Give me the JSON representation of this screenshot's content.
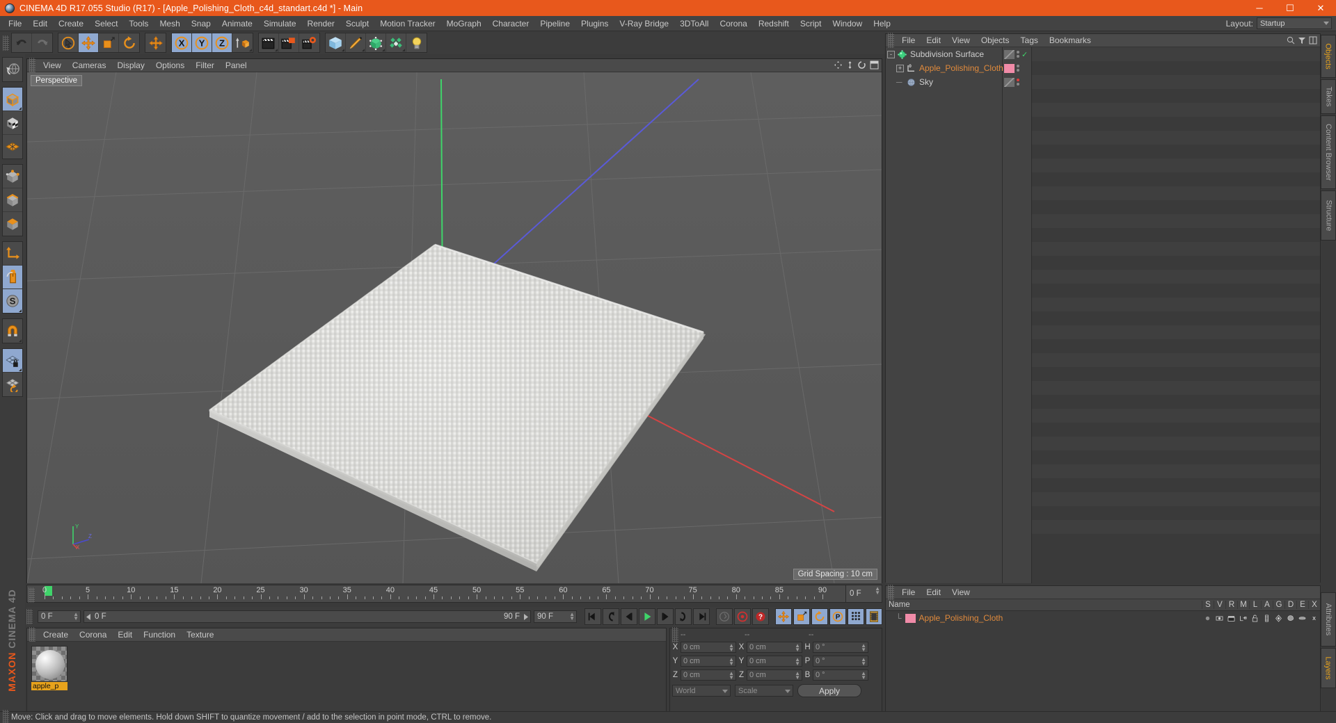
{
  "titlebar": {
    "title": "CINEMA 4D R17.055 Studio (R17) - [Apple_Polishing_Cloth_c4d_standart.c4d *] - Main",
    "minimize": "─",
    "maximize": "☐",
    "close": "✕"
  },
  "menubar": {
    "items": [
      "File",
      "Edit",
      "Create",
      "Select",
      "Tools",
      "Mesh",
      "Snap",
      "Animate",
      "Simulate",
      "Render",
      "Sculpt",
      "Motion Tracker",
      "MoGraph",
      "Character",
      "Pipeline",
      "Plugins",
      "V-Ray Bridge",
      "3DToAll",
      "Corona",
      "Redshift",
      "Script",
      "Window",
      "Help"
    ],
    "layout_label": "Layout:",
    "layout_value": "Startup"
  },
  "toolbar": {
    "groups": [
      {
        "buttons": [
          {
            "name": "undo-button",
            "icon": "undo",
            "active": false
          },
          {
            "name": "redo-button",
            "icon": "redo",
            "active": false
          }
        ]
      },
      {
        "buttons": [
          {
            "name": "live-selection-tool",
            "icon": "cursor-circle",
            "active": false
          },
          {
            "name": "move-tool",
            "icon": "move-arrows",
            "active": true
          },
          {
            "name": "scale-tool",
            "icon": "scale-box",
            "active": false
          },
          {
            "name": "rotate-tool",
            "icon": "rotate-arc",
            "active": false
          }
        ]
      },
      {
        "buttons": [
          {
            "name": "world-axis-tool",
            "icon": "move-arrows",
            "active": false
          }
        ]
      },
      {
        "buttons": [
          {
            "name": "lock-x-axis",
            "icon": "axis-x",
            "active": true
          },
          {
            "name": "lock-y-axis",
            "icon": "axis-y",
            "active": true
          },
          {
            "name": "lock-z-axis",
            "icon": "axis-z",
            "active": true
          },
          {
            "name": "world-object-coordinates",
            "icon": "world-cube",
            "active": false
          }
        ]
      },
      {
        "buttons": [
          {
            "name": "render-view-button",
            "icon": "clapper",
            "active": false
          },
          {
            "name": "render-to-picture-viewer",
            "icon": "clapper-region",
            "active": false
          },
          {
            "name": "render-settings-button",
            "icon": "clapper-gear",
            "active": false
          }
        ]
      },
      {
        "buttons": [
          {
            "name": "add-cube-primitive",
            "icon": "cube-blue",
            "active": false
          },
          {
            "name": "add-spline-pen",
            "icon": "pen",
            "active": false
          },
          {
            "name": "add-generator",
            "icon": "green-cube-nurbs",
            "active": false
          },
          {
            "name": "add-deformer",
            "icon": "green-scatter",
            "active": false
          },
          {
            "name": "add-scene-object",
            "icon": "light-bulb",
            "active": false
          }
        ]
      }
    ]
  },
  "left_toolbar": {
    "groups": [
      {
        "buttons": [
          {
            "name": "undo-view-button",
            "icon": "globe-undo",
            "active": false
          }
        ]
      },
      {
        "buttons": [
          {
            "name": "model-mode",
            "icon": "cube-orange-outline",
            "active": true
          },
          {
            "name": "texture-mode",
            "icon": "cube-checker",
            "active": false
          },
          {
            "name": "points-mode-grid",
            "icon": "orange-grid",
            "active": false
          }
        ]
      },
      {
        "buttons": [
          {
            "name": "points-mode",
            "icon": "cube-points",
            "active": false
          },
          {
            "name": "edges-mode",
            "icon": "cube-edges",
            "active": false
          },
          {
            "name": "polygons-mode",
            "icon": "cube-polygons",
            "active": false
          }
        ]
      },
      {
        "buttons": [
          {
            "name": "axis-mode",
            "icon": "axis-L",
            "active": false
          },
          {
            "name": "viewport-solo-mouse",
            "icon": "mouse",
            "active": true
          },
          {
            "name": "enable-snap",
            "icon": "snap-s",
            "active": true
          }
        ]
      },
      {
        "buttons": [
          {
            "name": "magnet-tool",
            "icon": "magnet",
            "active": false
          }
        ]
      },
      {
        "buttons": [
          {
            "name": "workplane-lock",
            "icon": "grid-lock",
            "active": true
          },
          {
            "name": "workplane-reset",
            "icon": "grid-reset",
            "active": false
          }
        ]
      }
    ]
  },
  "viewport": {
    "menu": [
      "View",
      "Cameras",
      "Display",
      "Options",
      "Filter",
      "Panel"
    ],
    "label": "Perspective",
    "grid_spacing": "Grid Spacing : 10 cm",
    "icons": [
      "move-view-icon",
      "zoom-view-icon",
      "rotate-view-icon",
      "maximize-view-icon"
    ],
    "axis_gizmo": {
      "y": "Y",
      "x": "X",
      "z": "Z"
    }
  },
  "object_manager": {
    "menu": [
      "File",
      "Edit",
      "View",
      "Objects",
      "Tags",
      "Bookmarks"
    ],
    "search_icons": [
      "search-icon",
      "filter-icon",
      "layout-icon"
    ],
    "nodes": [
      {
        "name": "Subdivision Surface",
        "icon": "subdivision-surface-icon",
        "indent": 0,
        "expander": "-",
        "selected": false,
        "swatch": "none",
        "check": "✓",
        "dot": "gray"
      },
      {
        "name": "Apple_Polishing_Cloth",
        "icon": "null-object-icon",
        "indent": 1,
        "expander": "+",
        "selected": true,
        "swatch": "#f08ba8",
        "check": "",
        "dot": "gray"
      },
      {
        "name": "Sky",
        "icon": "sky-icon",
        "indent": 1,
        "expander": "",
        "selected": false,
        "swatch": "none",
        "check": "",
        "dot": "red"
      }
    ]
  },
  "timeline": {
    "ticks": [
      0,
      5,
      10,
      15,
      20,
      25,
      30,
      35,
      40,
      45,
      50,
      55,
      60,
      65,
      70,
      75,
      80,
      85,
      90
    ],
    "start_frame": "0 F",
    "end_frame": "90 F",
    "current_frame": "0 F",
    "range_start": "0 F",
    "range_end": "90 F"
  },
  "transport": {
    "buttons": [
      {
        "name": "go-to-start-button",
        "icon": "skip-back"
      },
      {
        "name": "go-to-previous-key-button",
        "icon": "prev-key"
      },
      {
        "name": "go-to-previous-frame-button",
        "icon": "step-back"
      },
      {
        "name": "play-button",
        "icon": "play"
      },
      {
        "name": "go-to-next-frame-button",
        "icon": "step-fwd"
      },
      {
        "name": "go-to-next-key-button",
        "icon": "next-key"
      },
      {
        "name": "go-to-end-button",
        "icon": "skip-fwd"
      },
      {
        "name": "record-active-objects-button",
        "icon": "key-gray"
      },
      {
        "name": "autokeying-button",
        "icon": "record-red"
      },
      {
        "name": "keyframe-selection-button",
        "icon": "question-red"
      },
      {
        "name": "record-position-button",
        "icon": "move-arrows",
        "active": true
      },
      {
        "name": "record-scale-button",
        "icon": "scale-box",
        "active": true
      },
      {
        "name": "record-rotation-button",
        "icon": "rotate-arc",
        "active": true
      },
      {
        "name": "record-parameter-button",
        "icon": "param-p",
        "active": true
      },
      {
        "name": "record-pla-button",
        "icon": "dots-grid",
        "active": true
      },
      {
        "name": "timeline-button",
        "icon": "film-strip",
        "active": true
      }
    ]
  },
  "material_manager": {
    "menu": [
      "Create",
      "Corona",
      "Edit",
      "Function",
      "Texture"
    ],
    "materials": [
      {
        "name": "apple_p",
        "preview": "sphere-preview"
      }
    ]
  },
  "coordinates": {
    "headers": [
      "--",
      "--",
      "--"
    ],
    "rows": [
      {
        "label1": "X",
        "value1": "0 cm",
        "label2": "X",
        "value2": "0 cm",
        "label3": "H",
        "value3": "0 °"
      },
      {
        "label1": "Y",
        "value1": "0 cm",
        "label2": "Y",
        "value2": "0 cm",
        "label3": "P",
        "value3": "0 °"
      },
      {
        "label1": "Z",
        "value1": "0 cm",
        "label2": "Z",
        "value2": "0 cm",
        "label3": "B",
        "value3": "0 °"
      }
    ],
    "system": "World",
    "mode": "Scale",
    "apply": "Apply"
  },
  "layer_manager": {
    "menu": [
      "File",
      "Edit",
      "View"
    ],
    "columns": [
      "Name",
      "S",
      "V",
      "R",
      "M",
      "L",
      "A",
      "G",
      "D",
      "E",
      "X"
    ],
    "rows": [
      {
        "name": "Apple_Polishing_Cloth",
        "swatch": "#f08ba8"
      }
    ]
  },
  "right_tabs": [
    {
      "label": "Objects",
      "active": true
    },
    {
      "label": "Takes",
      "active": false
    },
    {
      "label": "Content Browser",
      "active": false
    },
    {
      "label": "Structure",
      "active": false
    },
    {
      "label": "Attributes",
      "active": false
    },
    {
      "label": "Layers",
      "active": true
    }
  ],
  "brand": {
    "maxon": "MAXON",
    "c4d": "CINEMA 4D"
  },
  "statusbar": {
    "text": "Move: Click and drag to move elements. Hold down SHIFT to quantize movement / add to the selection in point mode, CTRL to remove."
  }
}
